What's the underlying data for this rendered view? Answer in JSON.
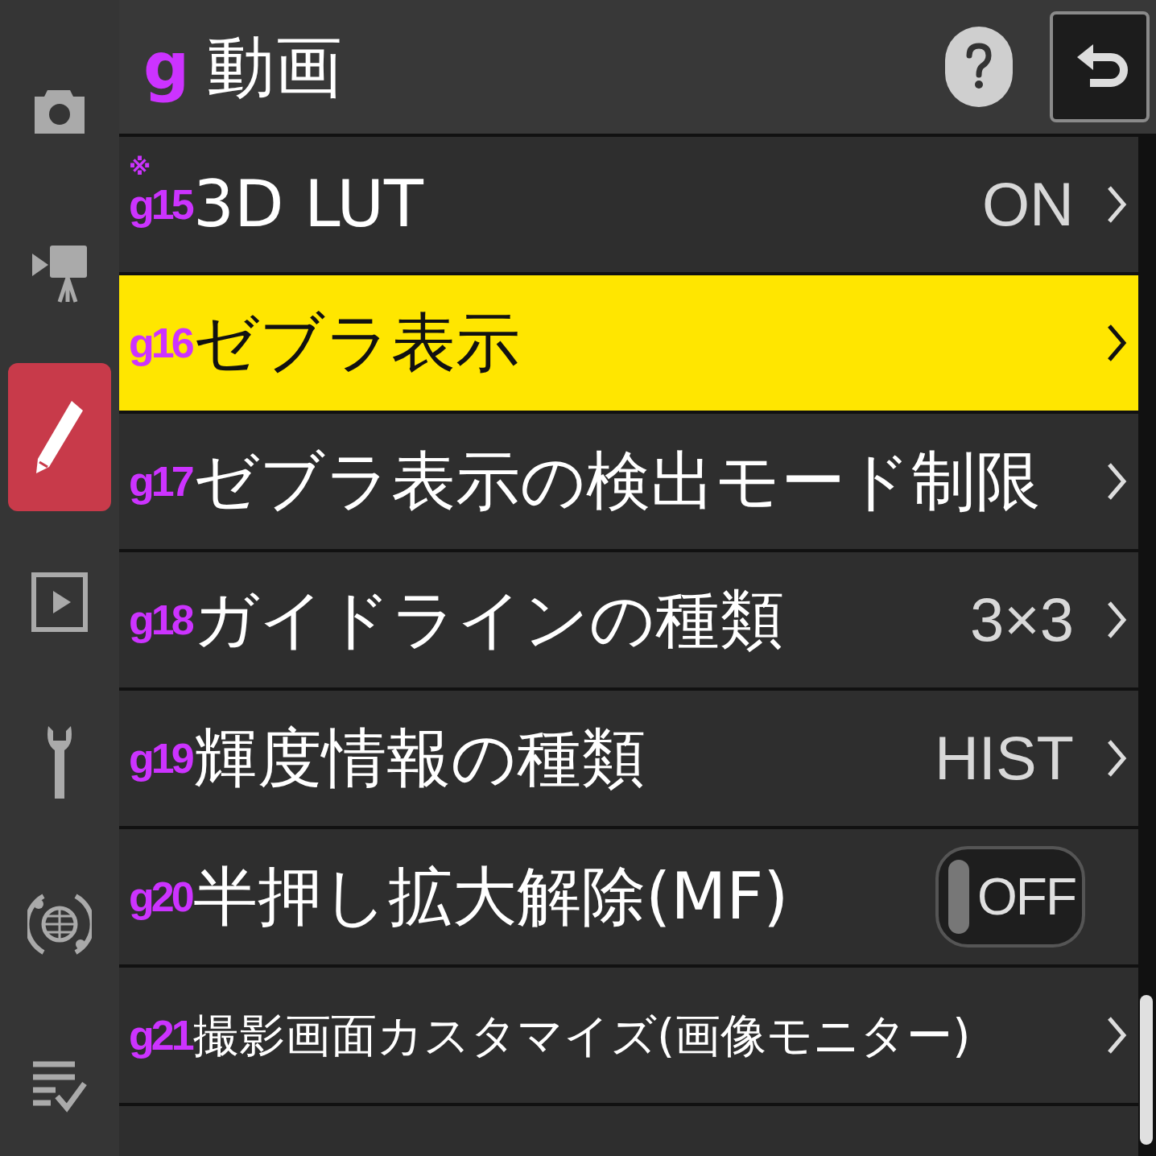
{
  "sidebar": {
    "items": [
      {
        "kind": "camera",
        "selected": false
      },
      {
        "kind": "video",
        "selected": false
      },
      {
        "kind": "pencil",
        "selected": true
      },
      {
        "kind": "playback",
        "selected": false
      },
      {
        "kind": "wrench",
        "selected": false
      },
      {
        "kind": "network",
        "selected": false
      },
      {
        "kind": "checklist",
        "selected": false
      }
    ]
  },
  "header": {
    "code": "g",
    "title": "動画"
  },
  "rows": [
    {
      "mark": "※",
      "code": "g15",
      "label": "3D LUT",
      "kind": "value",
      "value": "ON",
      "selected": false
    },
    {
      "code": "g16",
      "label": "ゼブラ表示",
      "kind": "submenu",
      "selected": true
    },
    {
      "code": "g17",
      "label": "ゼブラ表示の検出モード制限",
      "kind": "submenu",
      "selected": false
    },
    {
      "code": "g18",
      "label": "ガイドラインの種類",
      "kind": "value",
      "value": "3×3",
      "selected": false
    },
    {
      "code": "g19",
      "label": "輝度情報の種類",
      "kind": "value",
      "value": "HIST",
      "selected": false
    },
    {
      "code": "g20",
      "label": "半押し拡大解除(MF)",
      "kind": "toggle",
      "on": false,
      "value": "OFF",
      "selected": false
    },
    {
      "code": "g21",
      "label": "撮影画面カスタマイズ(画像モニター)",
      "kind": "submenu",
      "selected": false
    }
  ]
}
